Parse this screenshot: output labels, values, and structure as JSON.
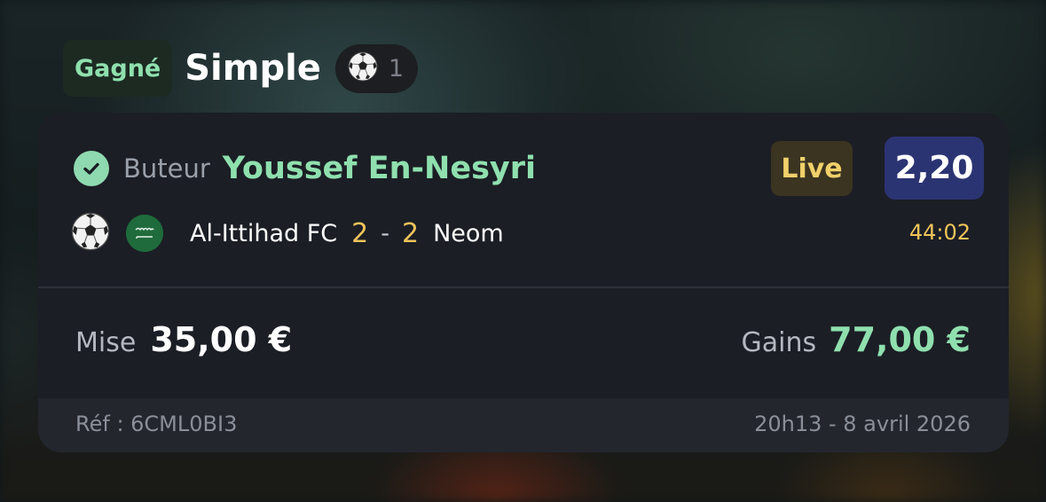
{
  "header": {
    "status": "Gagné",
    "bet_type": "Simple",
    "sport_icon": "soccer-ball-icon",
    "selection_count": "1"
  },
  "bet": {
    "market": "Buteur",
    "selection": "Youssef En-Nesyri",
    "live_label": "Live",
    "odds": "2,20",
    "sport_icon": "soccer-ball-icon",
    "competition_flag": "saudi-arabia-flag-icon",
    "home_team": "Al-Ittihad FC",
    "home_score": "2",
    "score_separator": "-",
    "away_score": "2",
    "away_team": "Neom",
    "match_clock": "44:02"
  },
  "summary": {
    "stake_label": "Mise",
    "stake_value": "35,00 €",
    "winnings_label": "Gains",
    "winnings_value": "77,00 €"
  },
  "footer": {
    "reference": "Réf : 6CML0BI3",
    "placed_at": "20h13 - 8 avril 2026"
  },
  "colors": {
    "accent_green": "#8fe0ae",
    "live_yellow": "#f0d06a",
    "odds_bg": "#2b3472",
    "card_bg": "#1b1e25"
  }
}
